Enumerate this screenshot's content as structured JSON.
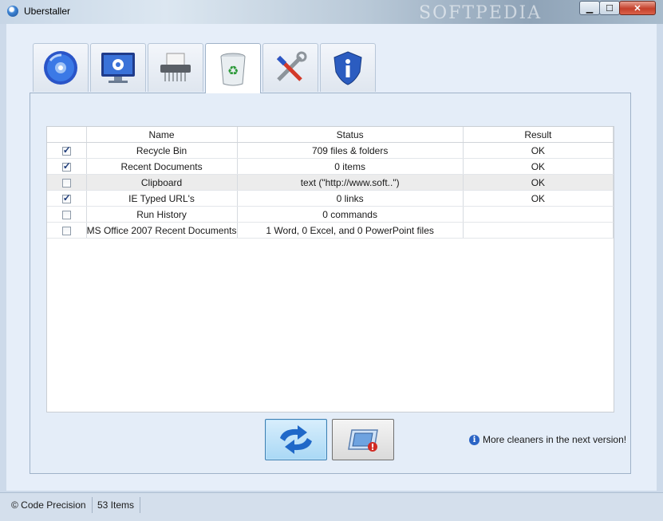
{
  "window": {
    "title": "Uberstaller",
    "controls": [
      "minimize",
      "maximize",
      "close"
    ]
  },
  "tabs": [
    {
      "icon": "cd-disc-icon"
    },
    {
      "icon": "monitor-settings-icon"
    },
    {
      "icon": "shredder-icon"
    },
    {
      "icon": "recycle-bin-icon",
      "active": true
    },
    {
      "icon": "tools-icon"
    },
    {
      "icon": "info-shield-icon"
    }
  ],
  "table": {
    "headers": {
      "check": "",
      "name": "Name",
      "status": "Status",
      "result": "Result"
    },
    "rows": [
      {
        "checked": true,
        "name": "Recycle Bin",
        "status": "709 files & folders",
        "result": "OK"
      },
      {
        "checked": true,
        "name": "Recent Documents",
        "status": "0 items",
        "result": "OK"
      },
      {
        "checked": false,
        "name": "Clipboard",
        "status": "text (\"http://www.soft..\")",
        "result": "OK",
        "selected": true
      },
      {
        "checked": true,
        "name": "IE Typed URL's",
        "status": "0 links",
        "result": "OK"
      },
      {
        "checked": false,
        "name": "Run History",
        "status": "0 commands",
        "result": ""
      },
      {
        "checked": false,
        "name": "MS Office 2007 Recent Documents",
        "status": "1 Word, 0 Excel, and 0 PowerPoint files",
        "result": ""
      }
    ]
  },
  "buttons": {
    "refresh_icon": "refresh-arrows-icon",
    "clean_icon": "clean-window-icon"
  },
  "info": {
    "text": "More cleaners in the next version!"
  },
  "statusbar": {
    "copyright": "© Code Precision",
    "items": "53 Items"
  },
  "watermark": "SOFTPEDIA",
  "colors": {
    "accent": "#2b64c5",
    "selection": "#ececec",
    "panel": "#e4edf8"
  }
}
